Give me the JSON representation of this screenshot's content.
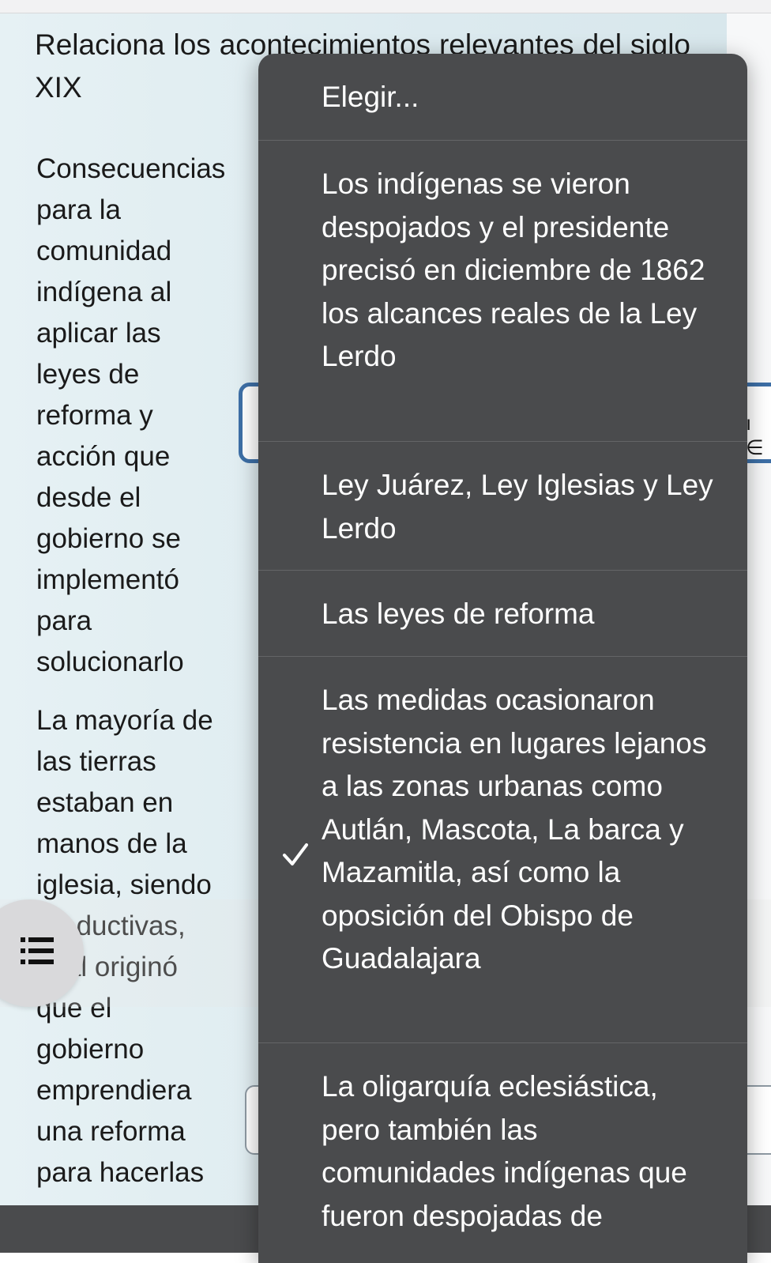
{
  "question": {
    "title": "Relaciona los acontecimientos relevantes del siglo XIX"
  },
  "prompts": [
    "Consecuencias\npara la\ncomunidad\nindígena  al\naplicar las\nleyes de\nreforma y\nacción que\ndesde el\ngobierno se\nimplementó\npara\nsolucionarlo",
    "La mayoría de\nlas tierras\nestaban en\nmanos de la\niglesia, siendo\nproductivas,\ncual originó\nque el\ngobierno\nemprendiera\nuna reforma\npara hacerlas"
  ],
  "dropdown": {
    "options": [
      {
        "label": "Elegir...",
        "selected": false
      },
      {
        "label": "Los indígenas se vieron despojados y el presidente precisó en diciembre de 1862 los alcances reales de la Ley Lerdo",
        "selected": false
      },
      {
        "label": "Ley Juárez, Ley Iglesias y Ley Lerdo",
        "selected": false
      },
      {
        "label": "Las leyes de reforma",
        "selected": false
      },
      {
        "label": "Las medidas ocasionaron resistencia en lugares lejanos a las zonas urbanas como Autlán, Mascota, La barca y Mazamitla, así como la oposición del Obispo de Guadalajara",
        "selected": true
      },
      {
        "label": "La oligarquía eclesiástica, pero también las comunidades indígenas que fueron despojadas de",
        "selected": false
      }
    ]
  },
  "fab": {
    "icon": "list-icon"
  },
  "colors": {
    "menu_background": "#4a4b4d",
    "focus_border": "#3d6fa6",
    "page_background": "#e1edf1"
  }
}
